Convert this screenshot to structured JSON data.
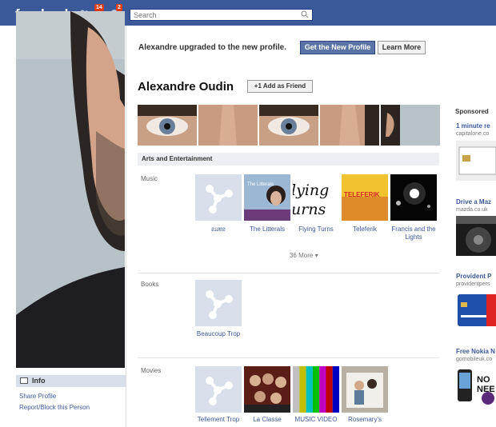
{
  "header": {
    "logo": "facebook",
    "friend_requests_count": "14",
    "notifications_count": "2",
    "search_placeholder": "Search"
  },
  "notice": {
    "text": "Alexandre upgraded to the new profile.",
    "get_button": "Get the New Profile",
    "learn_button": "Learn More"
  },
  "profile": {
    "name": "Alexandre Oudin",
    "add_friend": "Add as Friend"
  },
  "left": {
    "info_tab": "Info",
    "share": "Share Profile",
    "report": "Report/Block this Person"
  },
  "arts": {
    "heading": "Arts and Entertainment",
    "music_label": "Music",
    "music": [
      "ƨɹɹɐƨ",
      "The Litterals",
      "Flying Turns",
      "Teleferik",
      "Francis and the Lights"
    ],
    "album_text_litterals": "The Litterals",
    "album_text_flying": "Flying Turns",
    "album_text_teleferik": "TELEFERIK",
    "more": "36 More",
    "books_label": "Books",
    "books": [
      "Beaucoup Trop"
    ],
    "movies_label": "Movies",
    "movies": [
      "Tellement Trop",
      "La Classe",
      "MUSIC VIDEO",
      "Rosemary's"
    ]
  },
  "ads": {
    "sponsored": "Sponsored",
    "items": [
      {
        "title": "1 minute re",
        "url": "capitalone.co"
      },
      {
        "title": "Drive a Maz",
        "url": "mazda.co.uk"
      },
      {
        "title": "Provident P",
        "url": "providentpers"
      },
      {
        "title": "Free Nokia N",
        "url": "gomobileuk.co"
      }
    ],
    "nokia_text": "NO NEE"
  },
  "colors": {
    "brand": "#3b5998",
    "accent_button": "#5b74a8",
    "badge": "#dd3c10"
  }
}
